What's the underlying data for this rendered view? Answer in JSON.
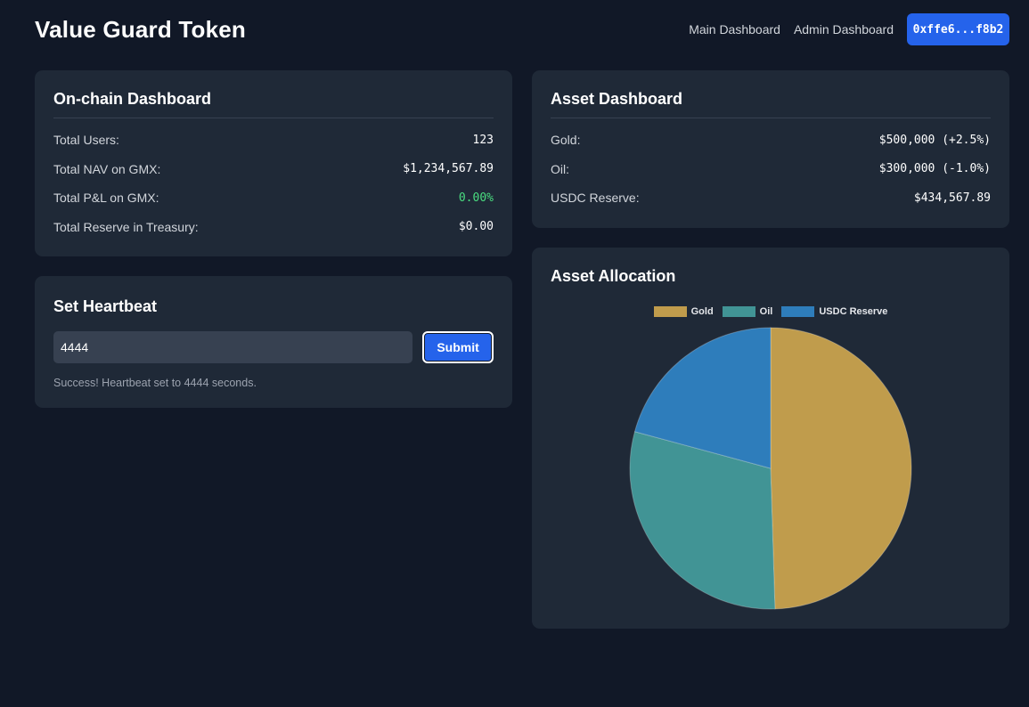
{
  "header": {
    "title": "Value Guard Token",
    "nav": [
      "Main Dashboard",
      "Admin Dashboard"
    ],
    "wallet": "0xffe6...f8b2"
  },
  "onchain": {
    "title": "On-chain Dashboard",
    "rows": [
      {
        "label": "Total Users:",
        "value": "123"
      },
      {
        "label": "Total NAV on GMX:",
        "value": "$1,234,567.89"
      },
      {
        "label": "Total P&L on GMX:",
        "value": "0.00%"
      },
      {
        "label": "Total Reserve in Treasury:",
        "value": "$0.00"
      }
    ]
  },
  "heartbeat": {
    "title": "Set Heartbeat",
    "input_value": "4444",
    "submit_label": "Submit",
    "status": "Success! Heartbeat set to 4444 seconds."
  },
  "assets": {
    "title": "Asset Dashboard",
    "rows": [
      {
        "label": "Gold:",
        "value": "$500,000 (+2.5%)"
      },
      {
        "label": "Oil:",
        "value": "$300,000 (-1.0%)"
      },
      {
        "label": "USDC Reserve:",
        "value": "$434,567.89"
      }
    ]
  },
  "allocation": {
    "title": "Asset Allocation"
  },
  "colors": {
    "gold": "#c09c4c",
    "oil": "#419495",
    "usdc": "#2e7dbb",
    "accent": "#2563eb",
    "positive": "#4ade80"
  },
  "chart_data": {
    "type": "pie",
    "legend_position": "top",
    "categories": [
      "Gold",
      "Oil",
      "USDC Reserve"
    ],
    "values": [
      500000,
      300000,
      210000
    ],
    "colors": [
      "#c09c4c",
      "#419495",
      "#2e7dbb"
    ]
  }
}
